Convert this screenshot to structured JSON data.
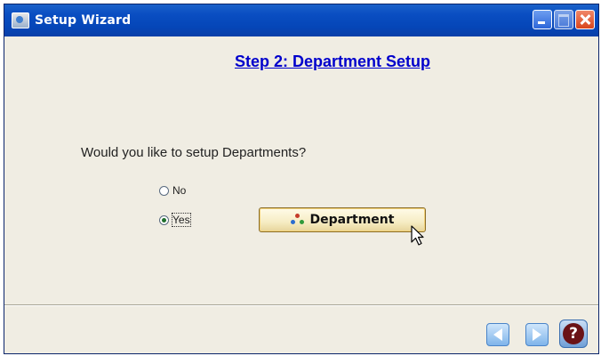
{
  "window": {
    "title": "Setup Wizard",
    "icon": "setup-wizard-icon",
    "controls": [
      "minimize-icon",
      "maximize-icon",
      "close-icon"
    ]
  },
  "step": {
    "title": "Step 2: Department Setup"
  },
  "question": "Would you like to setup Departments?",
  "options": {
    "no_label": "No",
    "yes_label": "Yes",
    "selected": "Yes"
  },
  "department_button": {
    "label": "Department",
    "icon": "department-icon"
  },
  "navigation": {
    "back_icon": "back-arrow-icon",
    "next_icon": "next-arrow-icon",
    "help_label": "?"
  },
  "colors": {
    "title_bar": "#0a4ec2",
    "step_title": "#0000cc",
    "window_background": "#f0ede3"
  }
}
